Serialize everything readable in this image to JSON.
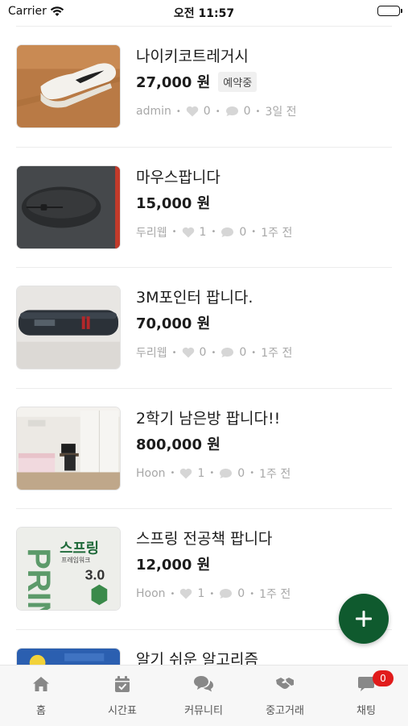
{
  "status_bar": {
    "carrier": "Carrier",
    "time": "오전 11:57"
  },
  "items": [
    {
      "title": "나이키코트레거시",
      "price": "27,000 원",
      "badge": "예약중",
      "seller": "admin",
      "likes": "0",
      "comments": "0",
      "time": "3일 전",
      "thumb_icon": "sneaker-photo"
    },
    {
      "title": "마우스팝니다",
      "price": "15,000 원",
      "badge": "",
      "seller": "두리웹",
      "likes": "1",
      "comments": "0",
      "time": "1주 전",
      "thumb_icon": "mouse-photo"
    },
    {
      "title": "3M포인터 팝니다.",
      "price": "70,000 원",
      "badge": "",
      "seller": "두리웹",
      "likes": "0",
      "comments": "0",
      "time": "1주 전",
      "thumb_icon": "pointer-photo"
    },
    {
      "title": "2학기 남은방 팝니다!!",
      "price": "800,000 원",
      "badge": "",
      "seller": "Hoon",
      "likes": "1",
      "comments": "0",
      "time": "1주 전",
      "thumb_icon": "room-photo"
    },
    {
      "title": "스프링 전공책 팝니다",
      "price": "12,000 원",
      "badge": "",
      "seller": "Hoon",
      "likes": "1",
      "comments": "0",
      "time": "1주 전",
      "thumb_icon": "book-photo",
      "thumb_text": {
        "title": "스프링",
        "sub": "프레임워크",
        "version": "3.0",
        "side": "PRIN"
      }
    },
    {
      "title": "알기 쉬운 알고리즘",
      "price": "",
      "badge": "",
      "seller": "",
      "likes": "",
      "comments": "",
      "time": "",
      "thumb_icon": "book-photo-blue"
    }
  ],
  "fab": {
    "icon": "plus-icon"
  },
  "tabs": [
    {
      "label": "홈",
      "icon": "home-icon"
    },
    {
      "label": "시간표",
      "icon": "calendar-icon"
    },
    {
      "label": "커뮤니티",
      "icon": "chat-bubbles-icon"
    },
    {
      "label": "중고거래",
      "icon": "handshake-icon"
    },
    {
      "label": "채팅",
      "icon": "chat-icon",
      "badge": "0"
    }
  ],
  "colors": {
    "accent": "#0f5a2e",
    "badge_red": "#e11b1b",
    "meta_gray": "#a8a8a8"
  }
}
